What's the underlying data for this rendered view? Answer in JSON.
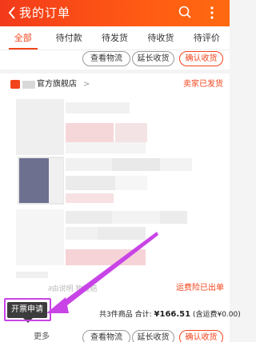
{
  "header": {
    "title": "我的订单"
  },
  "tabs": [
    {
      "label": "全部",
      "active": true
    },
    {
      "label": "待付款",
      "active": false
    },
    {
      "label": "待发货",
      "active": false
    },
    {
      "label": "待收货",
      "active": false
    },
    {
      "label": "待评价",
      "active": false
    }
  ],
  "order1": {
    "buttons": {
      "logistics": "查看物流",
      "extend": "延长收货",
      "confirm": "确认收货"
    }
  },
  "order2": {
    "shop_name": "官方旗舰店",
    "status": "卖家已发货",
    "insurance": "运费险已出单",
    "summary_count": "共3件商品",
    "summary_total_label": "合计:",
    "summary_total": "¥166.51",
    "summary_shipping": "(含运费¥0.00)",
    "buttons": {
      "logistics": "查看物流",
      "extend": "延长收货",
      "confirm": "确认收货"
    },
    "more": "更多",
    "tooltip": "开票申请",
    "partial_text": "∂由说明 物理赔"
  },
  "colors": {
    "brand": "#f2441c",
    "highlight": "#c844e6"
  }
}
